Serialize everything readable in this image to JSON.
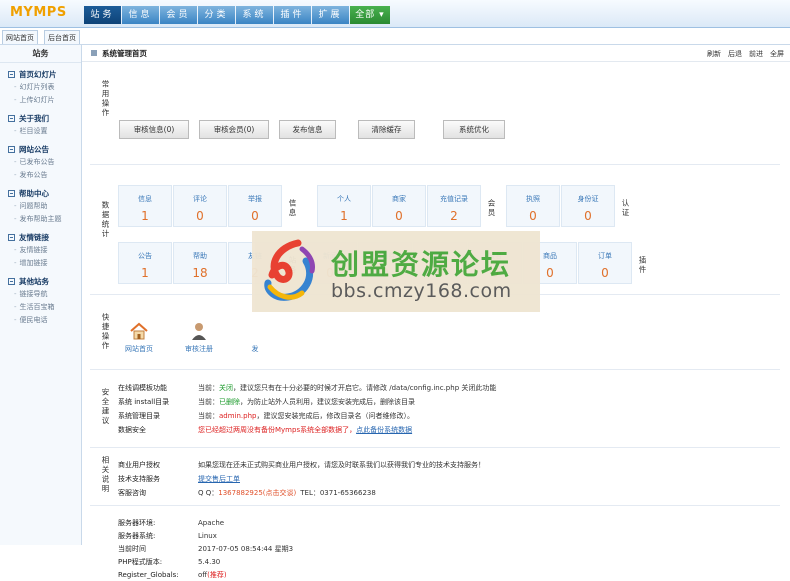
{
  "app": {
    "logo": "MYMPS"
  },
  "nav": {
    "items": [
      "站务",
      "信息",
      "会员",
      "分类",
      "系统",
      "插件",
      "扩展"
    ],
    "all_label": "全部"
  },
  "subtabs": [
    "网站首页",
    "后台首页"
  ],
  "sidebar": {
    "title": "站务",
    "groups": [
      {
        "title": "首页幻灯片",
        "items": [
          "幻灯片列表",
          "上传幻灯片"
        ]
      },
      {
        "title": "关于我们",
        "items": [
          "栏目设置"
        ]
      },
      {
        "title": "网站公告",
        "items": [
          "已发布公告",
          "发布公告"
        ]
      },
      {
        "title": "帮助中心",
        "items": [
          "问题帮助",
          "发布帮助主题"
        ]
      },
      {
        "title": "友情链接",
        "items": [
          "友情链接",
          "增加链接"
        ]
      },
      {
        "title": "其他站务",
        "items": [
          "链接导航",
          "生活百宝箱",
          "便民电话"
        ]
      }
    ]
  },
  "header": {
    "crumb": "系统管理首页",
    "actions": [
      "刷新",
      "后退",
      "前进",
      "全屏"
    ]
  },
  "shortcuts": {
    "label": "常用操作",
    "buttons": [
      "审核信息(0)",
      "审核会员(0)",
      "发布信息",
      "清除缓存",
      "系统优化"
    ]
  },
  "stats": {
    "label": "数据统计",
    "row1": {
      "info": {
        "cells": [
          {
            "label": "信息",
            "value": "1"
          },
          {
            "label": "评论",
            "value": "0"
          },
          {
            "label": "举报",
            "value": "0"
          }
        ],
        "tag": "信息"
      },
      "member": {
        "cells": [
          {
            "label": "个人",
            "value": "1"
          },
          {
            "label": "商家",
            "value": "0"
          },
          {
            "label": "充值记录",
            "value": "2"
          }
        ],
        "tag": "会员"
      },
      "auth": {
        "cells": [
          {
            "label": "执照",
            "value": "0"
          },
          {
            "label": "身份证",
            "value": "0"
          }
        ],
        "tag": "认证"
      }
    },
    "row2": {
      "site": {
        "cells": [
          {
            "label": "公告",
            "value": "1"
          },
          {
            "label": "帮助",
            "value": "18"
          },
          {
            "label": "友链",
            "value": "2"
          }
        ],
        "tag": "站务"
      },
      "plugin": {
        "cells": [
          {
            "label": "新闻",
            "value": "0"
          },
          {
            "label": "优惠券",
            "value": "0"
          },
          {
            "label": "团购",
            "value": "0"
          },
          {
            "label": "报名",
            "value": "0"
          },
          {
            "label": "商品",
            "value": "0"
          },
          {
            "label": "订单",
            "value": "0"
          }
        ],
        "tag": "插件"
      }
    }
  },
  "quick": {
    "label": "快捷操作",
    "items": [
      {
        "label": "网站首页",
        "icon": "home-icon"
      },
      {
        "label": "审核注册",
        "icon": "user-icon"
      },
      {
        "label": "发",
        "icon": "post-icon"
      }
    ]
  },
  "security": {
    "label": "安全建议",
    "rows": [
      {
        "k": "在线调模板功能",
        "pre": "当前：",
        "status": "关闭",
        "note": "，建议您只有在十分必要的时候才开启它。请修改 /data/config.inc.php 关闭此功能"
      },
      {
        "k": "系统 install目录",
        "pre": "当前：",
        "status": "已删除",
        "note": "，为防止站外人员利用，建议您安装完成后，删除该目录"
      },
      {
        "k": "系统管理目录",
        "pre": "当前：",
        "status": "admin.php",
        "note": "，建议您安装完成后，修改目录名（问者维修改）。"
      },
      {
        "k": "数据安全",
        "warn": "您已经超过两周没有备份Mymps系统全部数据了，",
        "link": "点此备份系统数据"
      }
    ]
  },
  "about": {
    "label": "相关说明",
    "rows": [
      {
        "k": "商业用户授权",
        "v": "如果您现在还未正式购买商业用户授权，请您及时联系我们以获得我们专业的技术支持服务！"
      },
      {
        "k": "技术支持服务",
        "link": "提交售后工单"
      },
      {
        "k": "客服咨询",
        "pre": "Q Q：",
        "qq": "1367882925(点击交谈)",
        "tel": "TEL：0371-65366238"
      }
    ]
  },
  "server": {
    "rows": [
      {
        "k": "服务器环境:",
        "v": "Apache"
      },
      {
        "k": "服务器系统:",
        "v": "Linux"
      },
      {
        "k": "当前时间",
        "v": "2017-07-05 08:54:44 星期3"
      },
      {
        "k": "PHP程式版本:",
        "v": "5.4.30"
      },
      {
        "k": "Register_Globals:",
        "v": "off",
        "extra": "(推荐)"
      }
    ]
  },
  "watermark": {
    "line1": "创盟资源论坛",
    "line2": "bbs.cmzy168.com"
  },
  "colors": {
    "nav_active": "#0e4378",
    "nav": "#3a84c4",
    "value": "#e0702a",
    "link": "#3a78b8",
    "green": "#1a9a2a",
    "red": "#dd2222",
    "watermark_green": "#49a83c"
  }
}
